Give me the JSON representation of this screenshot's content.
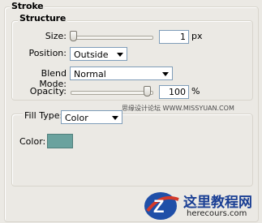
{
  "panel": {
    "title": "Stroke",
    "structure_title": "Structure"
  },
  "structure": {
    "size": {
      "label": "Size:",
      "value": "1",
      "unit": "px",
      "slider_fraction": 0.0
    },
    "position": {
      "label": "Position:",
      "value": "Outside"
    },
    "blend_mode": {
      "label": "Blend Mode:",
      "value": "Normal"
    },
    "opacity": {
      "label": "Opacity:",
      "value": "100",
      "unit": "%",
      "slider_fraction": 1.0
    }
  },
  "fill": {
    "type_label": "Fill Type:",
    "type_value": "Color",
    "color_label": "Color:",
    "color_hex": "#6aa29e"
  },
  "watermarks": {
    "top_right": "思缘设计论坛 WWW.MISSYUAN.COM",
    "logo_title": "这里教程网",
    "logo_url": "herecours.com"
  }
}
